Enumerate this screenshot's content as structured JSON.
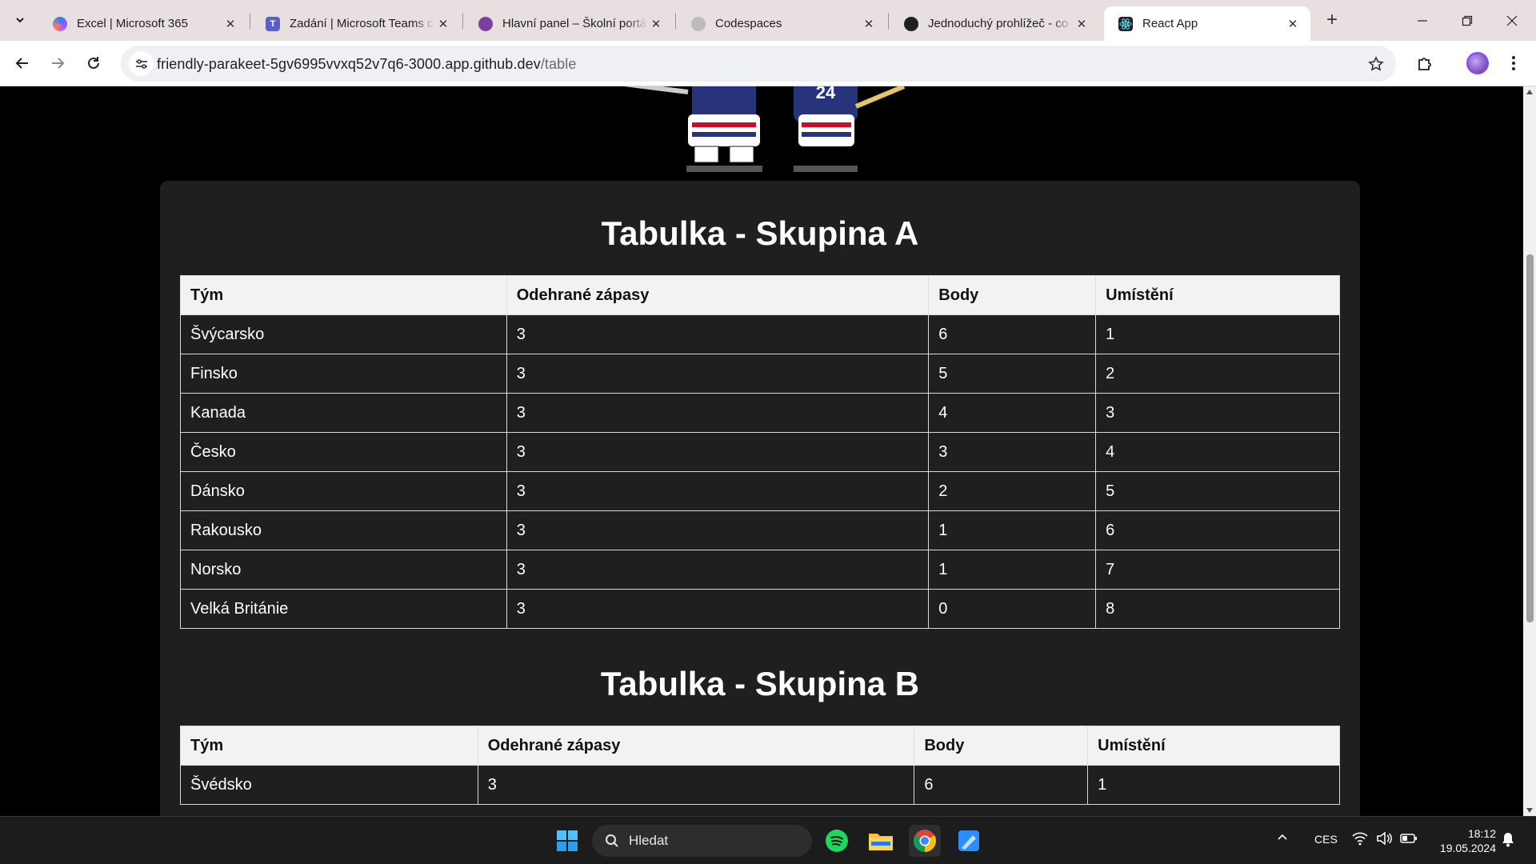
{
  "browser": {
    "tabs": [
      {
        "title": "Excel | Microsoft 365",
        "icon": "copilot-icon",
        "active": false
      },
      {
        "title": "Zadání | Microsoft Teams c",
        "icon": "teams-icon",
        "active": false
      },
      {
        "title": "Hlavní panel – Školní portá",
        "icon": "moodle-icon",
        "active": false
      },
      {
        "title": "Codespaces",
        "icon": "github-icon",
        "active": false
      },
      {
        "title": "Jednoduchý prohlížeč - co",
        "icon": "github-icon",
        "active": false
      },
      {
        "title": "React App",
        "icon": "react-icon",
        "active": true
      }
    ],
    "url_host": "friendly-parakeet-5gv6995vvxq52v7q6-3000.app.github.dev",
    "url_path": "/table"
  },
  "groups": [
    {
      "title": "Tabulka - Skupina A",
      "columns": [
        "Tým",
        "Odehrané zápasy",
        "Body",
        "Umístění"
      ],
      "rows": [
        [
          "Švýcarsko",
          "3",
          "6",
          "1"
        ],
        [
          "Finsko",
          "3",
          "5",
          "2"
        ],
        [
          "Kanada",
          "3",
          "4",
          "3"
        ],
        [
          "Česko",
          "3",
          "3",
          "4"
        ],
        [
          "Dánsko",
          "3",
          "2",
          "5"
        ],
        [
          "Rakousko",
          "3",
          "1",
          "6"
        ],
        [
          "Norsko",
          "3",
          "1",
          "7"
        ],
        [
          "Velká Británie",
          "3",
          "0",
          "8"
        ]
      ]
    },
    {
      "title": "Tabulka - Skupina B",
      "columns": [
        "Tým",
        "Odehrané zápasy",
        "Body",
        "Umístění"
      ],
      "rows": [
        [
          "Švédsko",
          "3",
          "6",
          "1"
        ]
      ]
    }
  ],
  "mascot": {
    "jersey_number": "24"
  },
  "taskbar": {
    "search_label": "Hledat",
    "language": "CES",
    "time": "18:12",
    "date": "19.05.2024"
  }
}
